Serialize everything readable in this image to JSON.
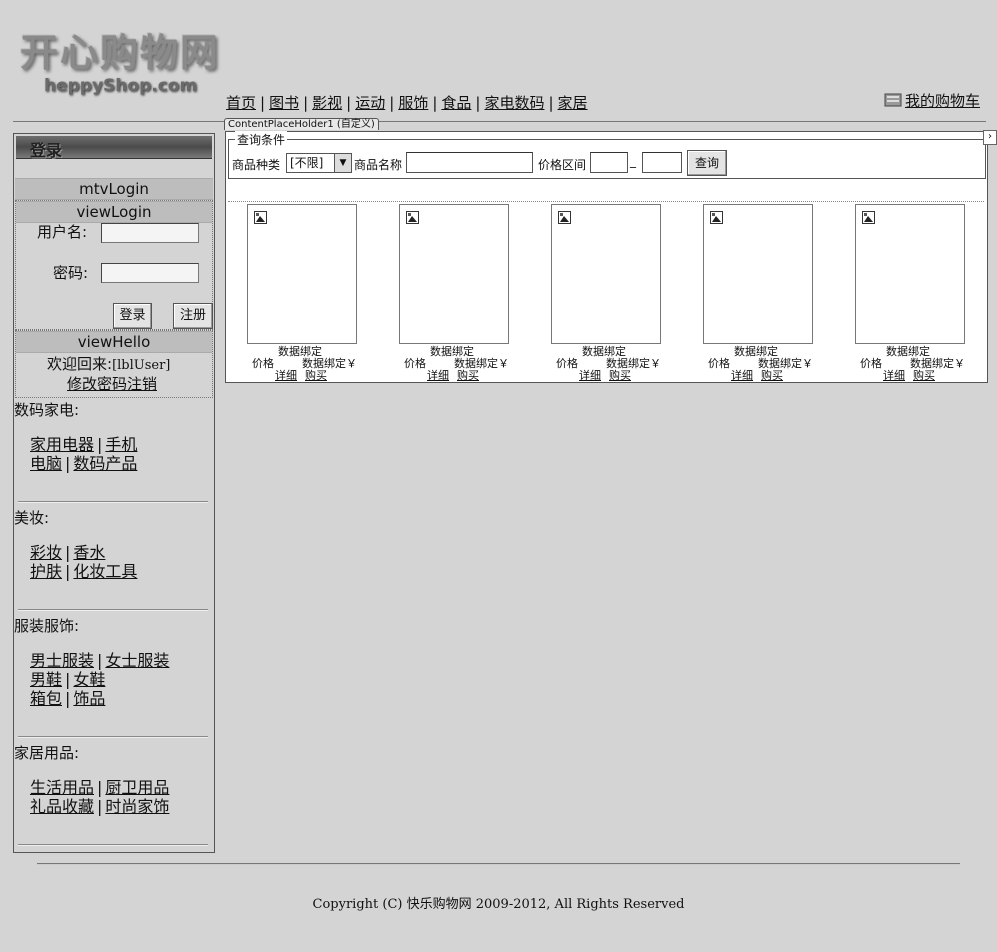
{
  "logo": {
    "title": "开心购物网",
    "subtitle": "heppyShop.com"
  },
  "nav": {
    "items": [
      "首页",
      "图书",
      "影视",
      "运动",
      "服饰",
      "食品",
      "家电数码",
      "家居"
    ],
    "separator": "|",
    "cart": "我的购物车"
  },
  "placeholder_tab": "ContentPlaceHolder1 (自定义)",
  "login": {
    "header": "登录",
    "mtv": "mtvLogin",
    "view_login": "viewLogin",
    "username_label": "用户名:",
    "password_label": "密码:",
    "login_button": "登录",
    "register_button": "注册",
    "view_hello": "viewHello",
    "welcome": "欢迎回来:",
    "user_placeholder": "[lblUser]",
    "change_password": "修改密码",
    "logout": "注销"
  },
  "categories": [
    {
      "title": "数码家电:",
      "rows": [
        [
          "家用电器",
          "手机"
        ],
        [
          "电脑",
          "数码产品"
        ]
      ]
    },
    {
      "title": "美妆:",
      "rows": [
        [
          "彩妆",
          "香水"
        ],
        [
          "护肤",
          "化妆工具"
        ]
      ]
    },
    {
      "title": "服装服饰:",
      "rows": [
        [
          "男士服装",
          "女士服装"
        ],
        [
          "男鞋",
          "女鞋"
        ],
        [
          "箱包",
          "饰品"
        ]
      ]
    },
    {
      "title": "家居用品:",
      "rows": [
        [
          "生活用品",
          "厨卫用品"
        ],
        [
          "礼品收藏",
          "时尚家饰"
        ]
      ]
    }
  ],
  "query": {
    "legend": "查询条件",
    "category_label": "商品种类",
    "category_value": "[不限]",
    "name_label": "商品名称",
    "price_label": "价格区间",
    "range_sep": "_",
    "search_button": "查询"
  },
  "products": [
    {
      "name": "数据绑定",
      "price_label": "价格",
      "price": "数据绑定￥",
      "detail": "详细",
      "buy": "购买"
    },
    {
      "name": "数据绑定",
      "price_label": "价格",
      "price": "数据绑定￥",
      "detail": "详细",
      "buy": "购买"
    },
    {
      "name": "数据绑定",
      "price_label": "价格",
      "price": "数据绑定￥",
      "detail": "详细",
      "buy": "购买"
    },
    {
      "name": "数据绑定",
      "price_label": "价格",
      "price": "数据绑定￥",
      "detail": "详细",
      "buy": "购买"
    },
    {
      "name": "数据绑定",
      "price_label": "价格",
      "price": "数据绑定￥",
      "detail": "详细",
      "buy": "购买"
    }
  ],
  "expand_glyph": "›",
  "footer": {
    "copyright": "Copyright (C) 快乐购物网 2009-2012, All Rights Reserved"
  }
}
